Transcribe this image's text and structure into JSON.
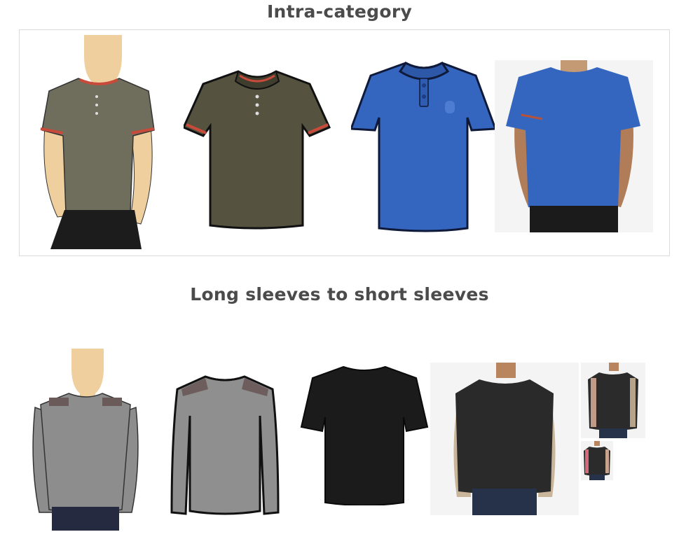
{
  "sections": [
    {
      "title": "Intra-category",
      "images": [
        "sketch of man wearing olive polo shirt with red trim",
        "olive polo shirt illustration",
        "blue polo shirt illustration",
        "photo of man wearing generated blue polo shirt"
      ]
    },
    {
      "title": "Long sleeves to short sleeves",
      "images": [
        "sketch of man wearing grey long-sleeve sweater",
        "grey long-sleeve sweater illustration",
        "black short-sleeve t-shirt illustration",
        "photo of man wearing generated black shirt",
        "smaller generated result",
        "smallest generated result"
      ]
    }
  ],
  "colors": {
    "olive": "#6f6d5b",
    "olive_dark": "#55533f",
    "trim_red": "#c74a3a",
    "blue": "#3566bf",
    "grey_sweater": "#8d8d8d",
    "black_shirt": "#1b1b1b",
    "skin": "#efcf9e"
  }
}
